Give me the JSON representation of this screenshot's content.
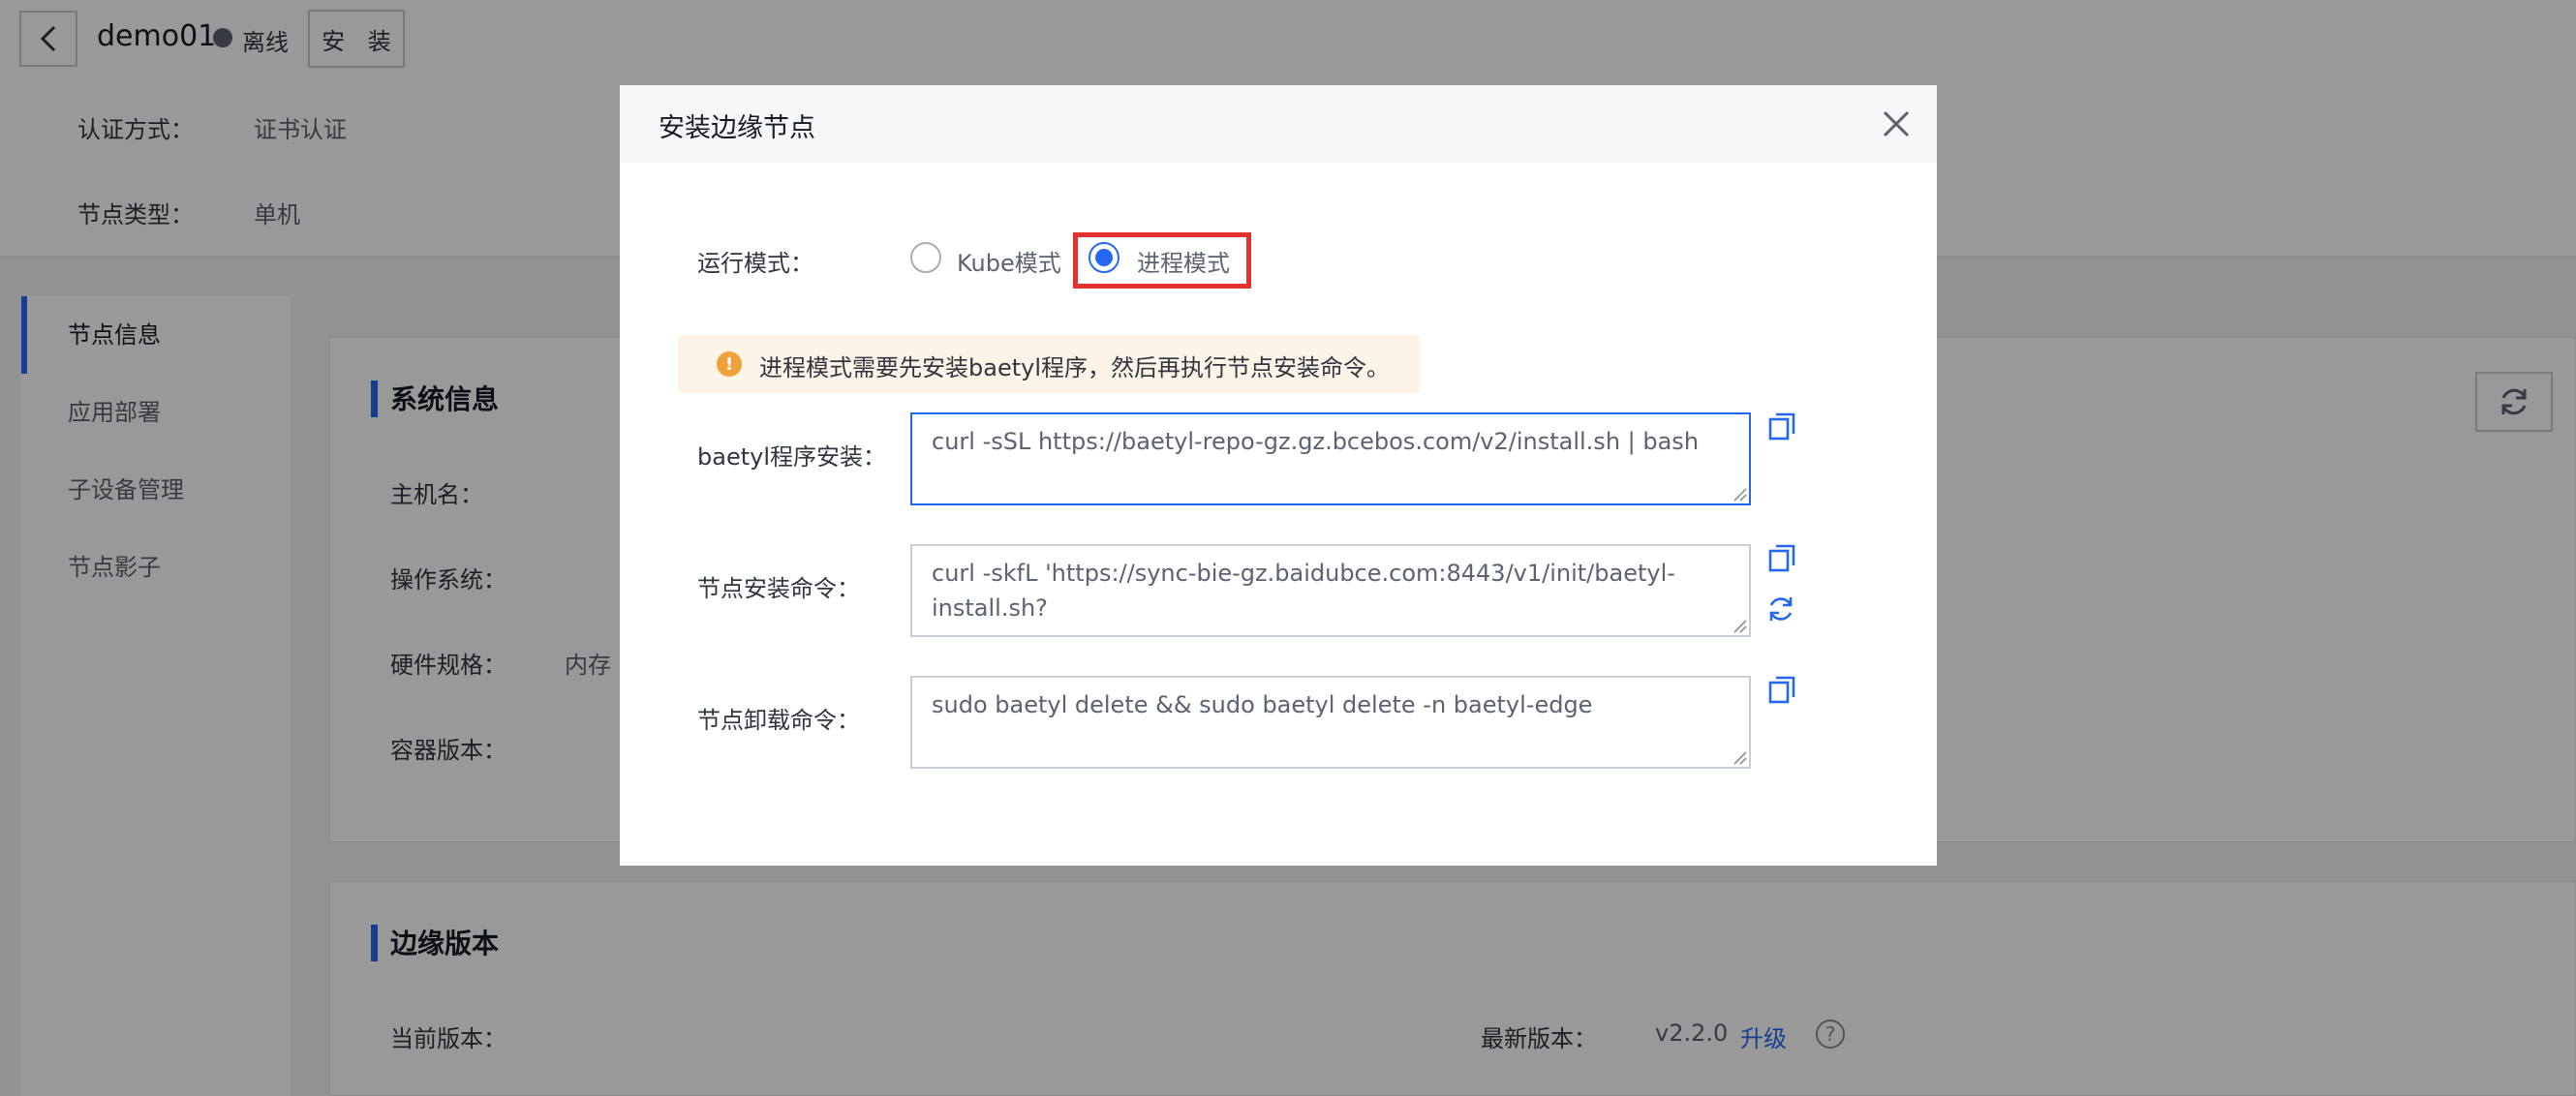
{
  "header": {
    "node_name": "demo01",
    "status": "离线",
    "install_label": "安 装",
    "auth_label": "认证方式：",
    "auth_value": "证书认证",
    "type_label": "节点类型：",
    "type_value": "单机"
  },
  "sidebar": {
    "items": [
      {
        "label": "节点信息"
      },
      {
        "label": "应用部署"
      },
      {
        "label": "子设备管理"
      },
      {
        "label": "节点影子"
      }
    ]
  },
  "system_info": {
    "title": "系统信息",
    "hostname_label": "主机名：",
    "os_label": "操作系统：",
    "hardware_label": "硬件规格：",
    "hardware_value": "内存",
    "container_label": "容器版本："
  },
  "edge_version": {
    "title": "边缘版本",
    "current_label": "当前版本：",
    "latest_label": "最新版本：",
    "latest_value": "v2.2.0",
    "upgrade_label": "升级",
    "help": "?"
  },
  "modal": {
    "title": "安装边缘节点",
    "run_mode_label": "运行模式：",
    "mode_kube": "Kube模式",
    "mode_process": "进程模式",
    "selected_mode": "进程模式",
    "alert": "进程模式需要先安装baetyl程序，然后再执行节点安装命令。",
    "baetyl_install_label": "baetyl程序安装：",
    "baetyl_install_cmd": "curl -sSL https://baetyl-repo-gz.gz.bcebos.com/v2/install.sh | bash",
    "node_install_label": "节点安装命令：",
    "node_install_cmd": "curl -skfL 'https://sync-bie-gz.baidubce.com:8443/v1/init/baetyl-install.sh?",
    "node_uninstall_label": "节点卸载命令：",
    "node_uninstall_cmd": "sudo baetyl delete && sudo baetyl delete -n baetyl-edge"
  },
  "colors": {
    "accent": "#2468f2",
    "highlight": "#e5322e",
    "warning": "#f0a23a"
  },
  "icons": {
    "back": "chevron-left-icon",
    "close": "close-icon",
    "copy": "copy-icon",
    "regenerate": "refresh-icon",
    "warning": "warning-icon"
  }
}
